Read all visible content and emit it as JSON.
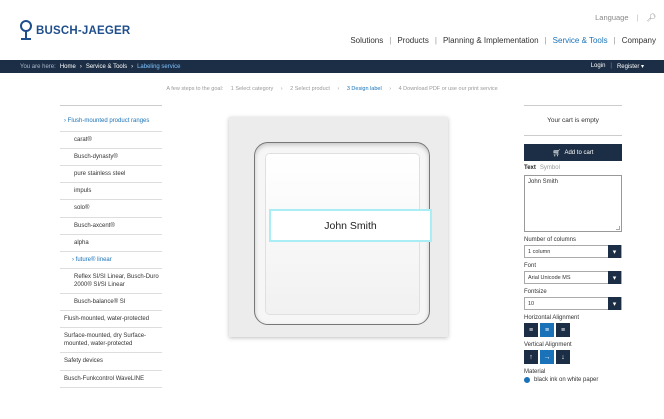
{
  "header": {
    "brand": "BUSCH-JAEGER",
    "language_label": "Language",
    "search_icon": "search-icon",
    "nav": [
      "Solutions",
      "Products",
      "Planning & Implementation",
      "Service & Tools",
      "Company"
    ],
    "nav_active": "Service & Tools"
  },
  "breadcrumb": {
    "prefix": "You are here:",
    "items": [
      "Home",
      "Service & Tools",
      "Labeling service"
    ],
    "login": "Login",
    "register": "Register ▾"
  },
  "steps": {
    "intro": "A few steps to the goal:",
    "items": [
      "1 Select category",
      "2 Select product",
      "3 Design label",
      "4 Download PDF or use our print service"
    ],
    "active_index": 2,
    "separator": "›"
  },
  "sidebar": {
    "top": "› Flush-mounted product ranges",
    "items": [
      "carat®",
      "Busch-dynasty®",
      "pure stainless steel",
      "impuls",
      "solo®",
      "Busch-axcent®",
      "alpha"
    ],
    "active": "› future® linear",
    "sub_items": [
      "Reflex SI/SI Linear, Busch-Duro 2000® SI/SI Linear",
      "Busch-balance® SI"
    ],
    "groups": [
      "Flush-mounted, water-protected",
      "Surface-mounted, dry Surface-mounted, water-protected",
      "Safety devices",
      "Busch-Funkcontrol WaveLINE"
    ]
  },
  "preview": {
    "label_text": "John Smith"
  },
  "panel": {
    "cart_status": "Your cart is empty",
    "add_to_cart": "Add to cart",
    "cart_icon": "cart-icon",
    "tab_text": "Text",
    "tab_symbol": "Symbol",
    "text_value": "John Smith",
    "columns_label": "Number of columns",
    "columns_value": "1 column",
    "font_label": "Font",
    "font_value": "Arial Unicode MS",
    "fontsize_label": "Fontsize",
    "fontsize_value": "10",
    "halign_label": "Horizontal Alignment",
    "valign_label": "Vertical Alignment",
    "material_label": "Material",
    "material_value": "black ink on white paper",
    "colors": {
      "navy": "#1c2e45",
      "accent": "#1a73b8",
      "highlight": "#a8eef4"
    }
  }
}
